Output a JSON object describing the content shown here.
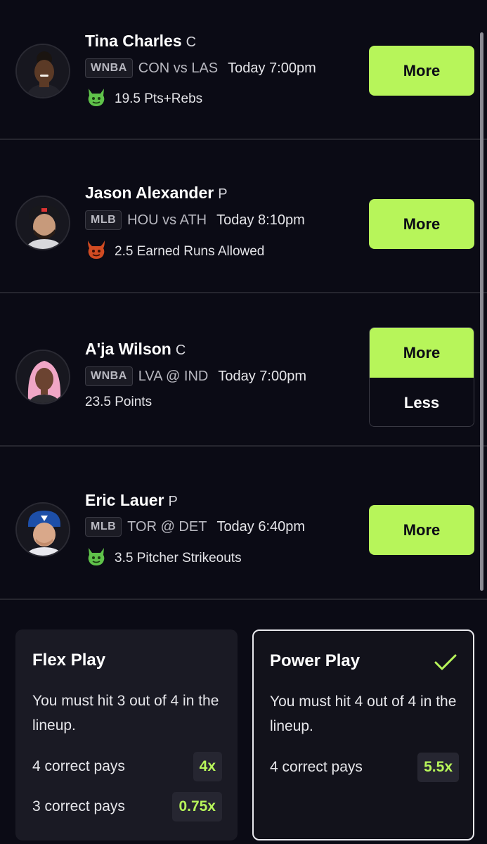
{
  "picks": [
    {
      "name": "Tina Charles",
      "position": "C",
      "league": "WNBA",
      "matchup": "CON vs LAS",
      "time": "Today 7:00pm",
      "stat": "19.5 Pts+Rebs",
      "modifier_icon": "goblin-icon",
      "more_label": "More"
    },
    {
      "name": "Jason Alexander",
      "position": "P",
      "league": "MLB",
      "matchup": "HOU vs ATH",
      "time": "Today 8:10pm",
      "stat": "2.5 Earned Runs Allowed",
      "modifier_icon": "demon-icon",
      "more_label": "More"
    },
    {
      "name": "A'ja Wilson",
      "position": "C",
      "league": "WNBA",
      "matchup": "LVA @ IND",
      "time": "Today 7:00pm",
      "stat": "23.5 Points",
      "more_label": "More",
      "less_label": "Less"
    },
    {
      "name": "Eric Lauer",
      "position": "P",
      "league": "MLB",
      "matchup": "TOR @ DET",
      "time": "Today 6:40pm",
      "stat": "3.5 Pitcher Strikeouts",
      "modifier_icon": "goblin-icon",
      "more_label": "More"
    }
  ],
  "play_types": {
    "flex": {
      "title": "Flex Play",
      "description": "You must hit 3 out of 4 in the lineup.",
      "payouts": [
        {
          "label": "4 correct pays",
          "multiplier": "4x"
        },
        {
          "label": "3 correct pays",
          "multiplier": "0.75x"
        }
      ],
      "selected": false
    },
    "power": {
      "title": "Power Play",
      "description": "You must hit 4 out of 4 in the lineup.",
      "payouts": [
        {
          "label": "4 correct pays",
          "multiplier": "5.5x"
        }
      ],
      "selected": true
    }
  },
  "colors": {
    "background": "#0b0b15",
    "accent": "#b7f55a",
    "card": "#1a1a24",
    "divider": "#26262f",
    "goblin": "#5fc24a",
    "demon": "#d14b22"
  }
}
